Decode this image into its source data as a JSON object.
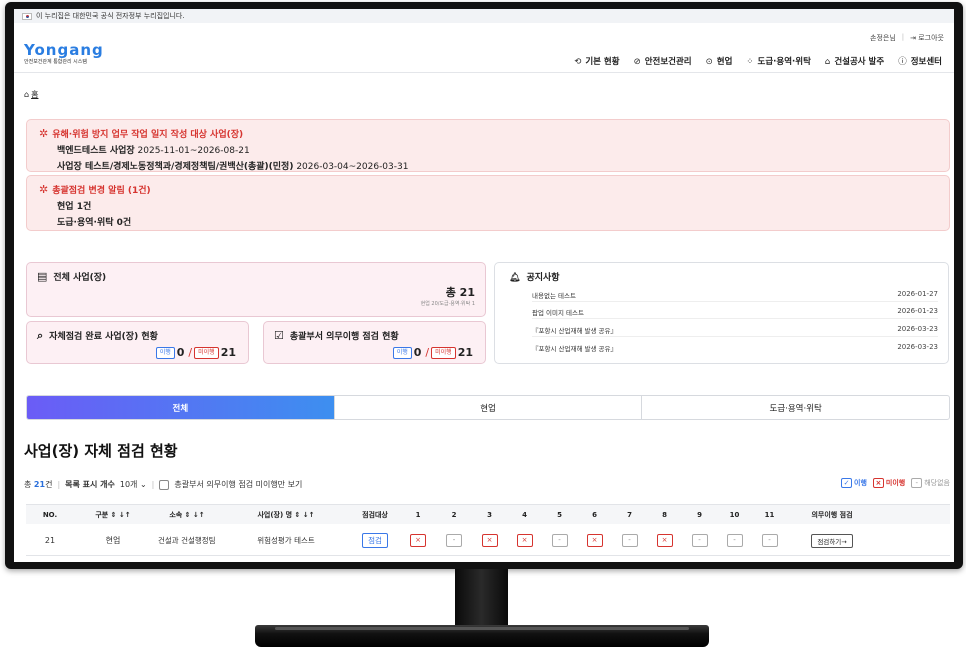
{
  "gov_banner": "이 누리집은 대한민국 공식 전자정부 누리집입니다.",
  "util": {
    "user": "손정은님",
    "logout": "로그아웃"
  },
  "logo": {
    "main1": "Yon",
    "main2": "g",
    "main3": "ang",
    "sub": "안전보건관계 통합관리 시스템",
    "city": "포항시"
  },
  "nav": [
    {
      "icon": "⟲",
      "label": "기본 현황"
    },
    {
      "icon": "⊘",
      "label": "안전보건관리"
    },
    {
      "icon": "⊙",
      "label": "현업"
    },
    {
      "icon": "⁘",
      "label": "도급·용역·위탁"
    },
    {
      "icon": "⌂",
      "label": "건설공사 발주"
    },
    {
      "icon": "ⓘ",
      "label": "정보센터"
    }
  ],
  "breadcrumb": {
    "icon": "⌂",
    "label": "홈"
  },
  "alert1": {
    "title": "유해·위험 방지 업무 작업 일지 작성 대상 사업(장)",
    "line1_b": "백엔드테스트 사업장",
    "line1": " 2025-11-01~2026-08-21",
    "line2_b": "사업장 테스트/경제노동정책과/경제정책팀/권백산(총괄)(민정)",
    "line2": " 2026-03-04~2026-03-31"
  },
  "alert2": {
    "title": "총괄점검 변경 알림 (1건)",
    "line1": "현업 1건",
    "line2": "도급·용역·위탁 0건"
  },
  "card_total": {
    "title": "전체 사업(장)",
    "total": "총 21",
    "sub": "현업 20/도급·용역·위탁 1"
  },
  "card_self": {
    "title": "자체점검 완료 사업(장) 현황",
    "done_label": "이행",
    "done": "0",
    "not_label": "미이행",
    "not": "21"
  },
  "card_duty": {
    "title": "총괄부서 의무이행 점검 현황",
    "done_label": "이행",
    "done": "0",
    "not_label": "미이행",
    "not": "21"
  },
  "notice": {
    "title": "공지사항",
    "rows": [
      {
        "t": "내용없는 테스트",
        "d": "2026-01-27"
      },
      {
        "t": "팝업 이미지 테스트",
        "d": "2026-01-23"
      },
      {
        "t": "『포항시 산업재해 발생 공유』",
        "d": "2026-03-23"
      },
      {
        "t": "『포항시 산업재해 발생 공유』",
        "d": "2026-03-23"
      }
    ]
  },
  "tabs": [
    "전체",
    "현업",
    "도급·용역·위탁"
  ],
  "section_title": "사업(장) 자체 점검 현황",
  "filter": {
    "total_prefix": "총",
    "total_num": "21",
    "total_suffix": "건",
    "list_label": "목록 표시 개수",
    "list_value": "10개",
    "check_label": "총괄부서 의무이행 점검 미이행만 보기"
  },
  "legend": {
    "done": "이행",
    "not": "미이행",
    "na": "해당없음"
  },
  "table": {
    "headers": [
      "NO.",
      "구분 ⇕ ↓↑",
      "소속 ⇕ ↓↑",
      "사업(장) 명 ⇕ ↓↑",
      "점검대상",
      "1",
      "2",
      "3",
      "4",
      "5",
      "6",
      "7",
      "8",
      "9",
      "10",
      "11",
      "의무이행 점검"
    ],
    "row": {
      "no": "21",
      "type": "현업",
      "dept": "건설과 건설행정팀",
      "name": "위험성평가 테스트",
      "target": "점검",
      "marks": [
        "x",
        "-",
        "x",
        "x",
        "-",
        "x",
        "-",
        "x",
        "-",
        "-",
        "-"
      ],
      "action": "점검하기→"
    }
  },
  "colors": {
    "accent": "#3a78e8",
    "danger": "#d6342f",
    "brand": "#1b3f8f"
  }
}
